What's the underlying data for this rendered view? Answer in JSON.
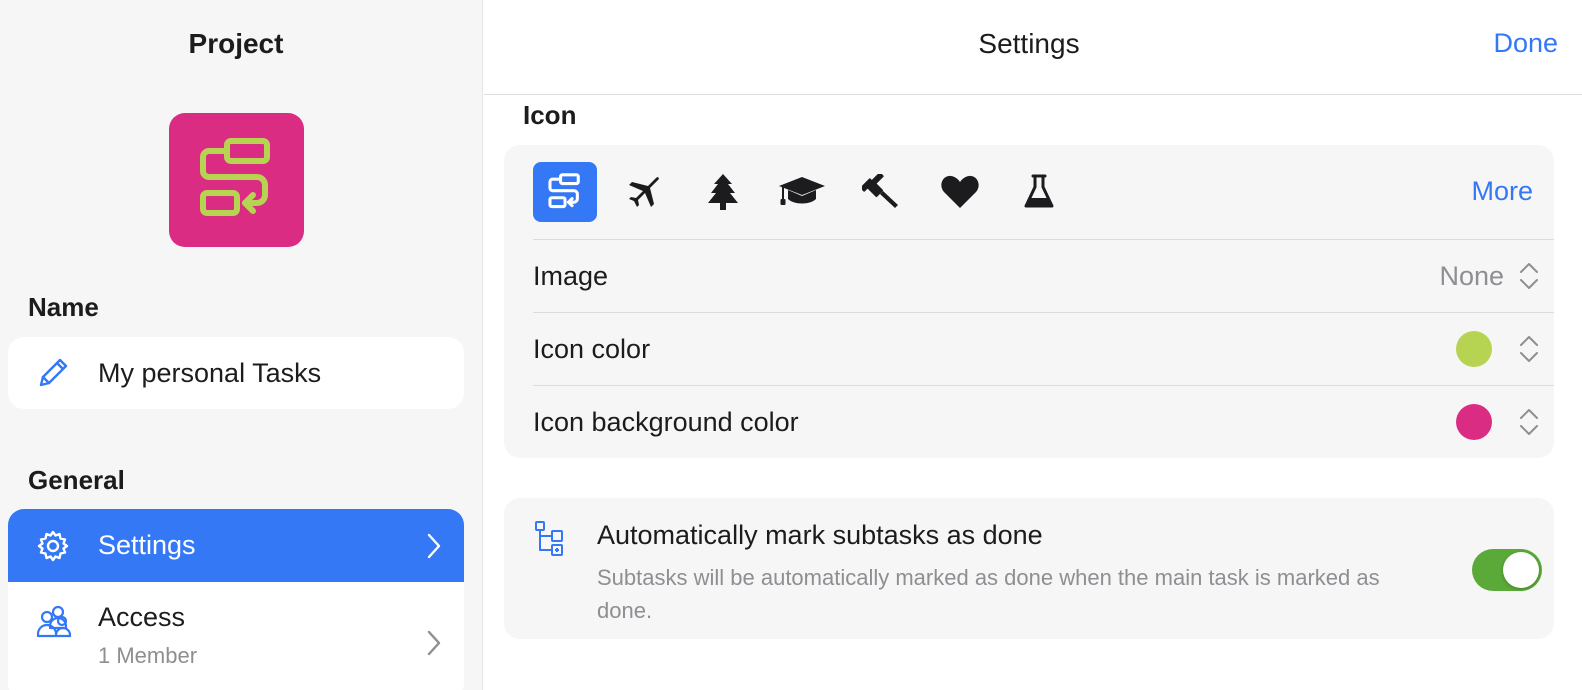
{
  "sidebar": {
    "title": "Project",
    "project_icon": {
      "name": "workflow-icon",
      "fg": "#b6d352",
      "bg": "#db2c84"
    },
    "name_section": {
      "label": "Name",
      "value": "My personal Tasks",
      "icon": "pencil-icon"
    },
    "general_section": {
      "label": "General",
      "items": [
        {
          "label": "Settings",
          "icon": "gear-icon",
          "active": true
        },
        {
          "label": "Access",
          "sublabel": "1 Member",
          "icon": "people-icon",
          "active": false
        }
      ]
    }
  },
  "header": {
    "title": "Settings",
    "done_label": "Done"
  },
  "icon_section": {
    "label": "Icon",
    "choices": [
      "workflow-icon",
      "airplane-icon",
      "tree-icon",
      "graduation-cap-icon",
      "gavel-icon",
      "heart-icon",
      "flask-icon"
    ],
    "selected_index": 0,
    "more_label": "More",
    "image": {
      "label": "Image",
      "value": "None"
    },
    "icon_color": {
      "label": "Icon color",
      "color": "#b6d352"
    },
    "icon_bg_color": {
      "label": "Icon background color",
      "color": "#db2c84"
    }
  },
  "subtasks": {
    "title": "Automatically mark subtasks as done",
    "description": "Subtasks will be automatically marked as done when the main task is marked as done.",
    "enabled": true,
    "icon": "subtask-tree-icon"
  },
  "colors": {
    "accent": "#3478f6",
    "toggle_on": "#5aa939"
  }
}
